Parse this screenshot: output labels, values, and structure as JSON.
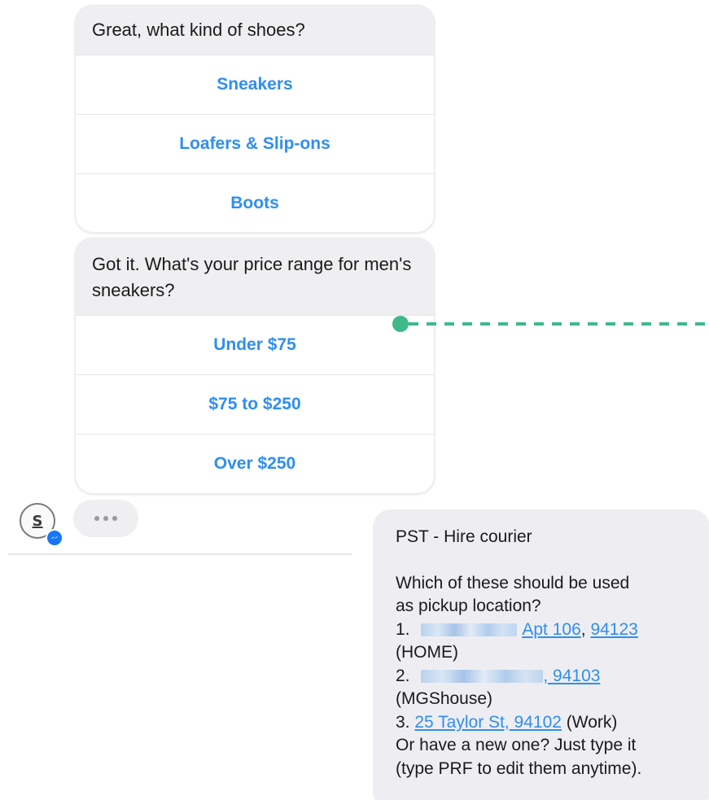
{
  "bot_card_shoes": {
    "question": "Great, what kind of shoes?",
    "options": [
      "Sneakers",
      "Loafers & Slip-ons",
      "Boots"
    ]
  },
  "bot_card_price": {
    "question": "Got it. What's your price range for men's sneakers?",
    "options": [
      "Under $75",
      "$75 to $250",
      "Over $250"
    ]
  },
  "avatar": {
    "letter": "S",
    "badge_icon": "messenger-icon"
  },
  "typing_indicator": {
    "dots": 3
  },
  "connector": {
    "color": "#3fb98a"
  },
  "pst_message": {
    "title": "PST - Hire courier",
    "prompt_line1": "Which of these should be used",
    "prompt_line2": "as pickup location?",
    "item1_num": "1.",
    "item1_link": "Apt 106",
    "item1_sep": ", ",
    "item1_zip": "94123",
    "item1_tag": "(HOME)",
    "item2_num": "2.",
    "item2_zip": ", 94103",
    "item2_tag": "(MGShouse)",
    "item3_num": "3.",
    "item3_link": "25 Taylor St, 94102",
    "item3_tag": " (Work)",
    "footer_line1": "Or have a new one? Just type it",
    "footer_line2": "(type PRF to edit them anytime)."
  },
  "colors": {
    "link_blue": "#2f8ef0",
    "bubble_gray": "#eeeef2",
    "accent_green": "#3fb98a",
    "messenger_blue": "#1877f2"
  }
}
